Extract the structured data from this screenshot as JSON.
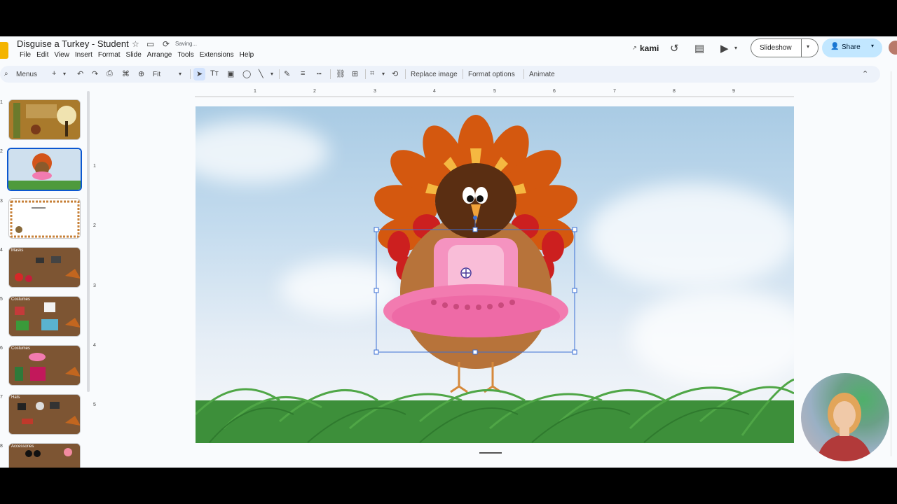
{
  "app": {
    "doc_title": "Disguise a Turkey - Student",
    "saving_status": "Saving...",
    "menu": [
      "File",
      "Edit",
      "View",
      "Insert",
      "Format",
      "Slide",
      "Arrange",
      "Tools",
      "Extensions",
      "Help"
    ],
    "kami_label": "kami",
    "slideshow_label": "Slideshow",
    "share_label": "Share"
  },
  "toolbar": {
    "search_label": "Menus",
    "zoom_label": "Fit",
    "replace_image_label": "Replace image",
    "format_options_label": "Format options",
    "animate_label": "Animate"
  },
  "filmstrip": {
    "slides": [
      {
        "number": "1",
        "label": ""
      },
      {
        "number": "2",
        "label": ""
      },
      {
        "number": "3",
        "label": ""
      },
      {
        "number": "4",
        "label": "Masks"
      },
      {
        "number": "5",
        "label": "Costumes"
      },
      {
        "number": "6",
        "label": "Costumes"
      },
      {
        "number": "7",
        "label": "Hats"
      },
      {
        "number": "8",
        "label": "Accessories"
      }
    ],
    "selected_index": 2
  },
  "ruler": {
    "horizontal": [
      "1",
      "2",
      "3",
      "4",
      "5",
      "6",
      "7",
      "8",
      "9"
    ],
    "vertical": [
      "1",
      "2",
      "3",
      "4",
      "5"
    ]
  },
  "colors": {
    "accent": "#0b57d0",
    "share_bg": "#c2e7ff",
    "toolbar_bg": "#edf2fa"
  }
}
